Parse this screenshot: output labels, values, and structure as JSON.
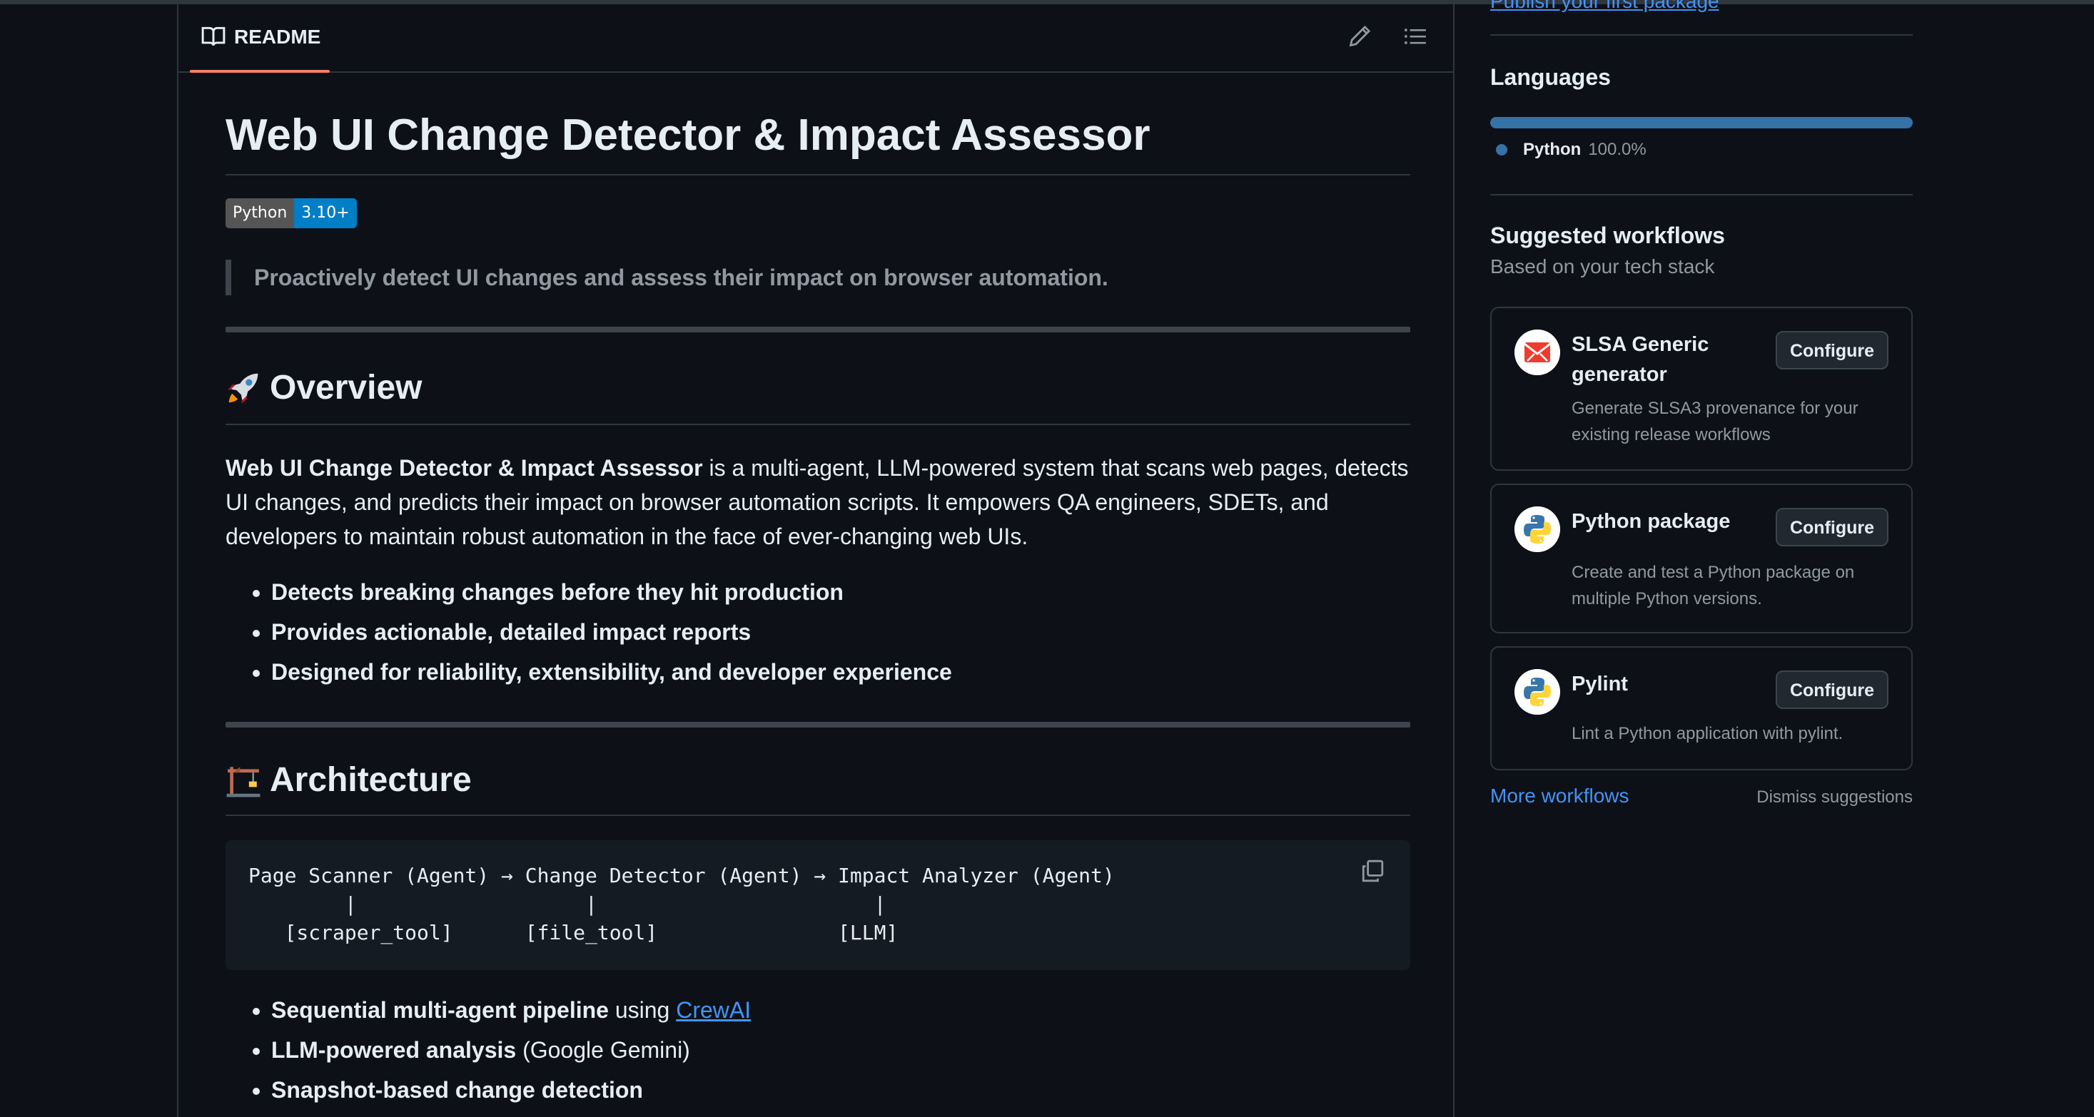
{
  "readme": {
    "tab_label": "README",
    "title": "Web UI Change Detector & Impact Assessor",
    "badge": {
      "label": "Python",
      "value": "3.10+"
    },
    "tagline": "Proactively detect UI changes and assess their impact on browser automation.",
    "overview": {
      "emoji": "rocket",
      "heading": "Overview",
      "intro_bold": "Web UI Change Detector & Impact Assessor",
      "intro_rest": " is a multi-agent, LLM-powered system that scans web pages, detects UI changes, and predicts their impact on browser automation scripts. It empowers QA engineers, SDETs, and developers to maintain robust automation in the face of ever-changing web UIs.",
      "bullets": [
        "Detects breaking changes before they hit production",
        "Provides actionable, detailed impact reports",
        "Designed for reliability, extensibility, and developer experience"
      ]
    },
    "architecture": {
      "emoji": "building-construction",
      "heading": "Architecture",
      "code": "Page Scanner (Agent) → Change Detector (Agent) → Impact Analyzer (Agent)\n        |                   |                       |\n   [scraper_tool]      [file_tool]               [LLM]",
      "bullets": [
        {
          "bold": "Sequential multi-agent pipeline",
          "plain": " using ",
          "link": "CrewAI"
        },
        {
          "bold": "LLM-powered analysis",
          "plain": " (Google Gemini)"
        },
        {
          "bold": "Snapshot-based change detection",
          "plain": ""
        }
      ]
    }
  },
  "sidebar": {
    "publish_link": "Publish your first package",
    "languages": {
      "heading": "Languages",
      "items": [
        {
          "name": "Python",
          "percent": "100.0%",
          "color": "#3572a5",
          "share": 1.0
        }
      ]
    },
    "suggested": {
      "heading": "Suggested workflows",
      "subheading": "Based on your tech stack",
      "workflows": [
        {
          "name": "SLSA Generic generator",
          "description": "Generate SLSA3 provenance for your existing release workflows",
          "button": "Configure",
          "icon": "slsa-icon"
        },
        {
          "name": "Python package",
          "description": "Create and test a Python package on multiple Python versions.",
          "button": "Configure",
          "icon": "python-icon"
        },
        {
          "name": "Pylint",
          "description": "Lint a Python application with pylint.",
          "button": "Configure",
          "icon": "python-icon"
        }
      ],
      "more_link": "More workflows",
      "dismiss": "Dismiss suggestions"
    }
  },
  "colors": {
    "background": "#0d1117",
    "border": "#30363d",
    "link": "#4493f8",
    "tab_underline": "#f78166",
    "muted_text": "#9198a1",
    "badge_left": "#555555",
    "badge_right": "#007ec6"
  }
}
